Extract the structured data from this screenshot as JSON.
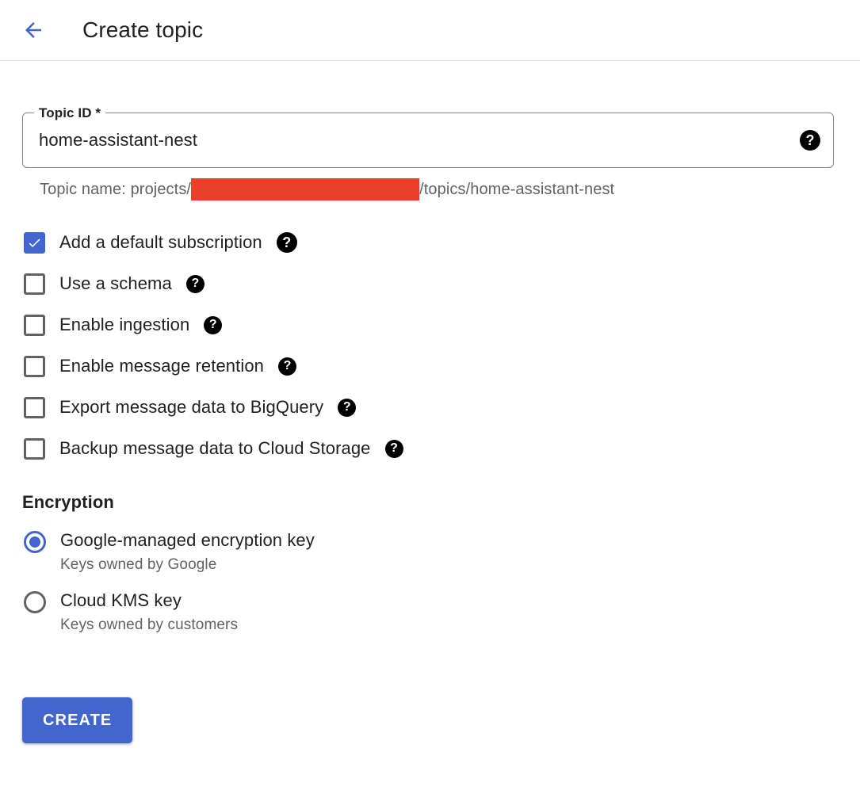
{
  "header": {
    "back_icon": "arrow-left-icon",
    "title": "Create topic",
    "accent_color": "#4266cd"
  },
  "topic_id_field": {
    "label": "Topic ID *",
    "value": "home-assistant-nest",
    "placeholder": "",
    "help_icon": "help-icon",
    "help_glyph": "?"
  },
  "helper": {
    "prefix": "Topic name: projects/",
    "redacted": "",
    "redaction_color": "#e8402a",
    "suffix": "/topics/home-assistant-nest"
  },
  "checkboxes": [
    {
      "label": "Add a default subscription",
      "checked": true,
      "help_glyph": "?"
    },
    {
      "label": "Use a schema",
      "checked": false,
      "help_glyph": "?"
    },
    {
      "label": "Enable ingestion",
      "checked": false,
      "help_glyph": "?"
    },
    {
      "label": "Enable message retention",
      "checked": false,
      "help_glyph": "?"
    },
    {
      "label": "Export message data to BigQuery",
      "checked": false,
      "help_glyph": "?"
    },
    {
      "label": "Backup message data to Cloud Storage",
      "checked": false,
      "help_glyph": "?"
    }
  ],
  "encryption": {
    "title": "Encryption",
    "options": [
      {
        "label": "Google-managed encryption key",
        "sub": "Keys owned by Google",
        "selected": true
      },
      {
        "label": "Cloud KMS key",
        "sub": "Keys owned by customers",
        "selected": false
      }
    ]
  },
  "actions": {
    "create_label": "CREATE"
  }
}
